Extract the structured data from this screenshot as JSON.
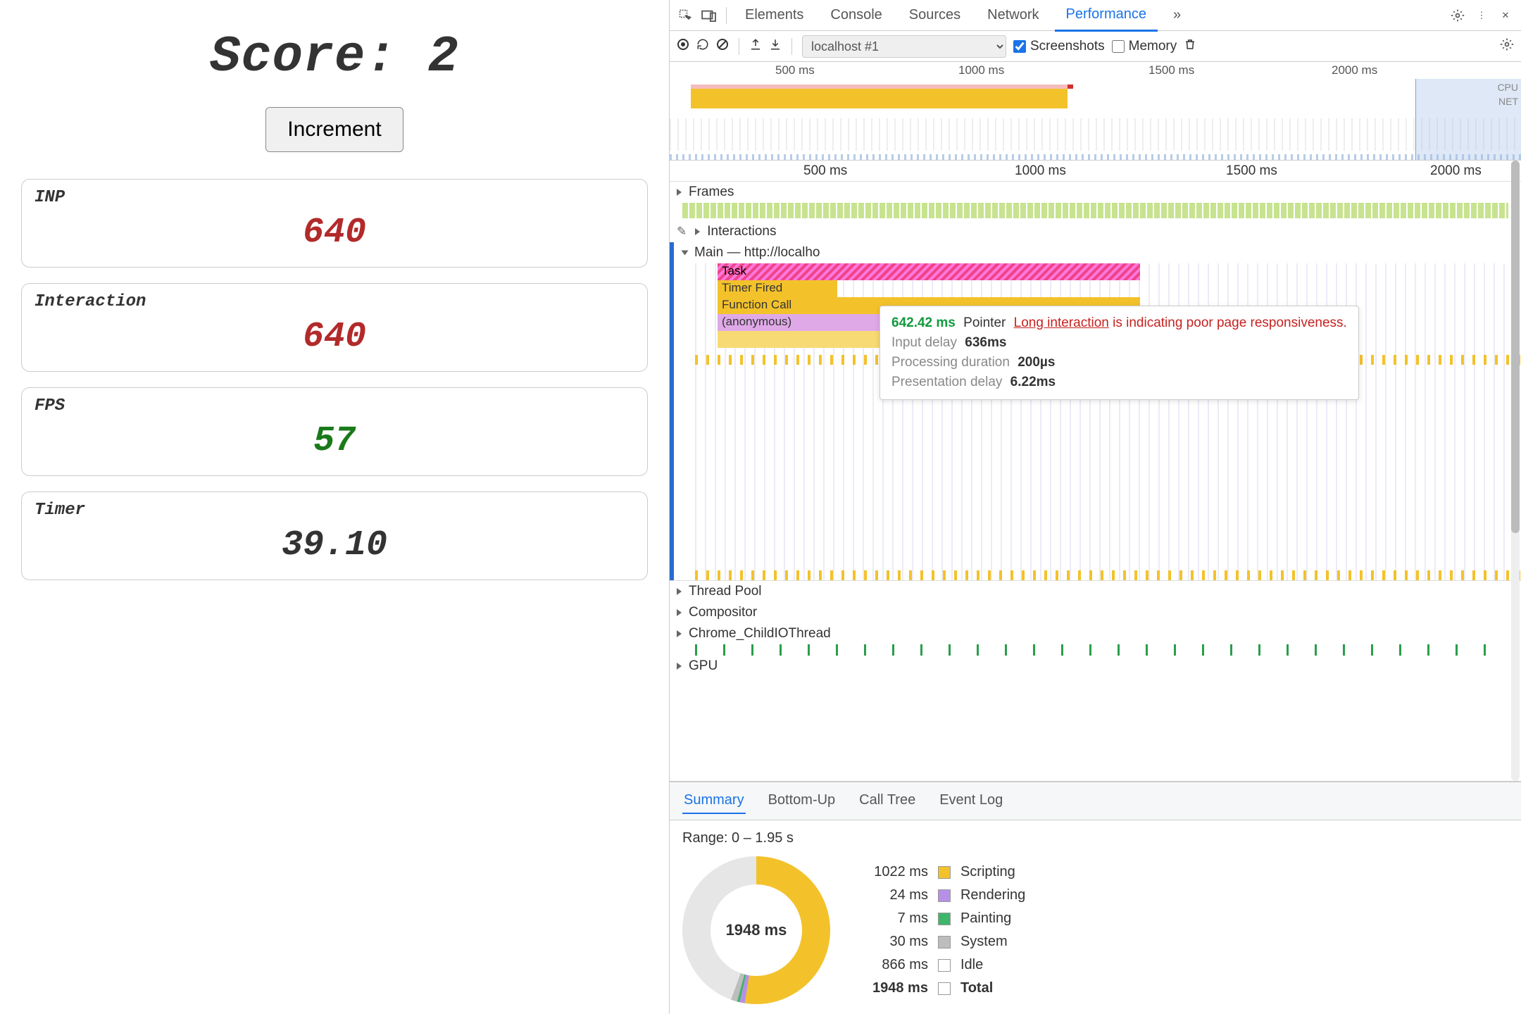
{
  "app": {
    "score_label": "Score:",
    "score_value": "2",
    "increment_label": "Increment",
    "cards": {
      "inp": {
        "label": "INP",
        "value": "640",
        "cls": "red"
      },
      "interaction": {
        "label": "Interaction",
        "value": "640",
        "cls": "red"
      },
      "fps": {
        "label": "FPS",
        "value": "57",
        "cls": "green"
      },
      "timer": {
        "label": "Timer",
        "value": "39.10",
        "cls": ""
      }
    }
  },
  "devtools": {
    "tabs": [
      "Elements",
      "Console",
      "Sources",
      "Network",
      "Performance"
    ],
    "more": "»",
    "toolbar": {
      "target": "localhost #1",
      "screenshots_label": "Screenshots",
      "memory_label": "Memory",
      "screenshots_checked": true,
      "memory_checked": false
    },
    "ruler_top": [
      "500 ms",
      "1000 ms",
      "1500 ms",
      "2000 ms"
    ],
    "overview_side": {
      "cpu": "CPU",
      "net": "NET"
    },
    "ruler2": [
      "500 ms",
      "1000 ms",
      "1500 ms",
      "2000 ms"
    ],
    "ruler2_selected": "s",
    "track_headers": {
      "frames": "Frames",
      "interactions": "Interactions",
      "main": "Main — http://localho",
      "thread_pool": "Thread Pool",
      "compositor": "Compositor",
      "child_io": "Chrome_ChildIOThread",
      "gpu": "GPU"
    },
    "flame_labels": {
      "task": "Task",
      "timer_fired": "Timer Fired",
      "function_call": "Function Call",
      "anonymous": "(anonymous)"
    },
    "tooltip": {
      "time": "642.42 ms",
      "type": "Pointer",
      "link_text": "Long interaction",
      "tail": " is indicating poor page responsiveness.",
      "rows": [
        {
          "label": "Input delay",
          "value": "636ms"
        },
        {
          "label": "Processing duration",
          "value": "200µs"
        },
        {
          "label": "Presentation delay",
          "value": "6.22ms"
        }
      ]
    },
    "summary_tabs": [
      "Summary",
      "Bottom-Up",
      "Call Tree",
      "Event Log"
    ],
    "range_label": "Range: 0 – 1.95 s",
    "donut_center": "1948 ms",
    "legend": [
      {
        "ms": "1022 ms",
        "sw": "sc",
        "name": "Scripting"
      },
      {
        "ms": "24 ms",
        "sw": "re",
        "name": "Rendering"
      },
      {
        "ms": "7 ms",
        "sw": "pa",
        "name": "Painting"
      },
      {
        "ms": "30 ms",
        "sw": "sy",
        "name": "System"
      },
      {
        "ms": "866 ms",
        "sw": "id",
        "name": "Idle"
      },
      {
        "ms": "1948 ms",
        "sw": "to",
        "name": "Total",
        "bold": true
      }
    ]
  }
}
